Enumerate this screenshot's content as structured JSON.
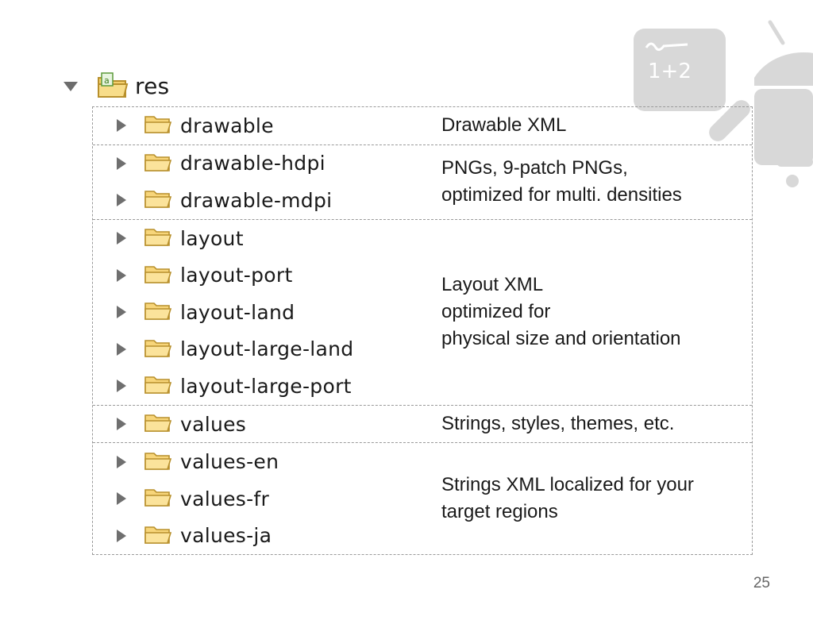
{
  "icons": {
    "folder": "folder-open-icon",
    "root": "resource-folder-icon",
    "expand": "triangle-right-icon",
    "collapse": "triangle-down-icon",
    "android": "android-robot-icon"
  },
  "colors": {
    "folder_fill": "#f7d57a",
    "folder_stroke": "#b8902c",
    "android_gray": "#d8d8d8",
    "border": "#9a9a9a",
    "twisty": "#6f6f6f"
  },
  "tree": {
    "root": {
      "label": "res"
    },
    "groups": [
      {
        "items": [
          "drawable"
        ],
        "description": "Drawable XML"
      },
      {
        "items": [
          "drawable-hdpi",
          "drawable-mdpi"
        ],
        "description": "PNGs, 9-patch PNGs,\noptimized for multi. densities"
      },
      {
        "items": [
          "layout",
          "layout-port",
          "layout-land",
          "layout-large-land",
          "layout-large-port"
        ],
        "description": "Layout XML\noptimized for\nphysical size and orientation"
      },
      {
        "items": [
          "values"
        ],
        "description": "Strings, styles, themes, etc."
      },
      {
        "items": [
          "values-en",
          "values-fr",
          "values-ja"
        ],
        "description": "Strings XML localized for your\ntarget regions"
      }
    ]
  },
  "board": {
    "text": "1+2"
  },
  "footer": {
    "page_number": "25"
  }
}
